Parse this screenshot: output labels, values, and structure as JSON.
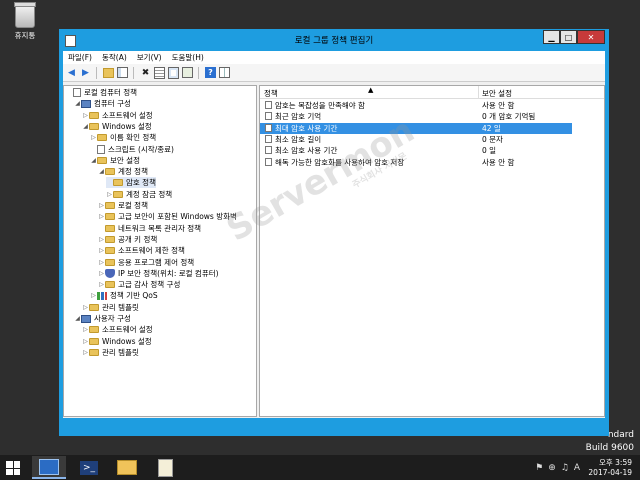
{
  "desktop": {
    "recycle_bin_label": "휴지통",
    "brand_line1": "ndard",
    "brand_line2": "Build 9600"
  },
  "window": {
    "title": "로컬 그룹 정책 편집기",
    "min_glyph": "▁",
    "max_glyph": "□",
    "close_glyph": "✕"
  },
  "menu": [
    "파일(F)",
    "동작(A)",
    "보기(V)",
    "도움말(H)"
  ],
  "toolbar": {
    "back": "◀",
    "forward": "▶",
    "delete": "✖",
    "help": "?"
  },
  "tree": [
    {
      "label": "로컬 컴퓨터 정책",
      "icon": "document-icon",
      "level": 0,
      "arrow": ""
    },
    {
      "label": "컴퓨터 구성",
      "icon": "computer-icon",
      "level": 1,
      "arrow": "◢"
    },
    {
      "label": "소프트웨어 설정",
      "icon": "folder-icon",
      "level": 2,
      "arrow": "▷"
    },
    {
      "label": "Windows 설정",
      "icon": "folder-icon",
      "level": 2,
      "arrow": "◢"
    },
    {
      "label": "이름 확인 정책",
      "icon": "folder-icon",
      "level": 3,
      "arrow": "▷"
    },
    {
      "label": "스크립트 (시작/종료)",
      "icon": "document-icon",
      "level": 3,
      "arrow": ""
    },
    {
      "label": "보안 설정",
      "icon": "folder-icon",
      "level": 3,
      "arrow": "◢"
    },
    {
      "label": "계정 정책",
      "icon": "folder-icon",
      "level": 4,
      "arrow": "◢"
    },
    {
      "label": "암호 정책",
      "icon": "folder-icon",
      "level": 5,
      "arrow": "",
      "selected": true
    },
    {
      "label": "계정 잠금 정책",
      "icon": "folder-icon",
      "level": 5,
      "arrow": "▷"
    },
    {
      "label": "로컬 정책",
      "icon": "folder-icon",
      "level": 4,
      "arrow": "▷"
    },
    {
      "label": "고급 보안이 포함된 Windows 방화벽",
      "icon": "folder-icon",
      "level": 4,
      "arrow": "▷"
    },
    {
      "label": "네트워크 목록 관리자 정책",
      "icon": "folder-icon",
      "level": 4,
      "arrow": ""
    },
    {
      "label": "공개 키 정책",
      "icon": "folder-icon",
      "level": 4,
      "arrow": "▷"
    },
    {
      "label": "소프트웨어 제한 정책",
      "icon": "folder-icon",
      "level": 4,
      "arrow": "▷"
    },
    {
      "label": "응용 프로그램 제어 정책",
      "icon": "folder-icon",
      "level": 4,
      "arrow": "▷"
    },
    {
      "label": "IP 보안 정책(위치: 로컬 컴퓨터)",
      "icon": "shield-icon",
      "level": 4,
      "arrow": "▷"
    },
    {
      "label": "고급 감사 정책 구성",
      "icon": "folder-icon",
      "level": 4,
      "arrow": "▷"
    },
    {
      "label": "정책 기반 QoS",
      "icon": "chart-icon",
      "level": 3,
      "arrow": "▷"
    },
    {
      "label": "관리 템플릿",
      "icon": "folder-icon",
      "level": 2,
      "arrow": "▷"
    },
    {
      "label": "사용자 구성",
      "icon": "user-icon",
      "level": 1,
      "arrow": "◢"
    },
    {
      "label": "소프트웨어 설정",
      "icon": "folder-icon",
      "level": 2,
      "arrow": "▷"
    },
    {
      "label": "Windows 설정",
      "icon": "folder-icon",
      "level": 2,
      "arrow": "▷"
    },
    {
      "label": "관리 템플릿",
      "icon": "folder-icon",
      "level": 2,
      "arrow": "▷"
    }
  ],
  "list": {
    "col_policy": "정책",
    "col_setting": "보안 설정",
    "sort_glyph": "▲",
    "rows": [
      {
        "name": "암호는 복잡성을 만족해야 함",
        "value": "사용 안 함"
      },
      {
        "name": "최근 암호 기억",
        "value": "0 개 암호 기억됨"
      },
      {
        "name": "최대 암호 사용 기간",
        "value": "42 일",
        "selected": true
      },
      {
        "name": "최소 암호 길이",
        "value": "0 문자"
      },
      {
        "name": "최소 암호 사용 기간",
        "value": "0 일"
      },
      {
        "name": "해독 가능한 암호화를 사용하여 암호 저장",
        "value": "사용 안 함"
      }
    ]
  },
  "watermark": {
    "text": "Servermon",
    "sub": "주식회사 서버몬"
  },
  "taskbar": {
    "tray_flag": "⚑",
    "tray_network": "⊕",
    "tray_volume": "♫",
    "tray_lang": "A",
    "time": "오후 3:59",
    "date": "2017-04-19"
  }
}
